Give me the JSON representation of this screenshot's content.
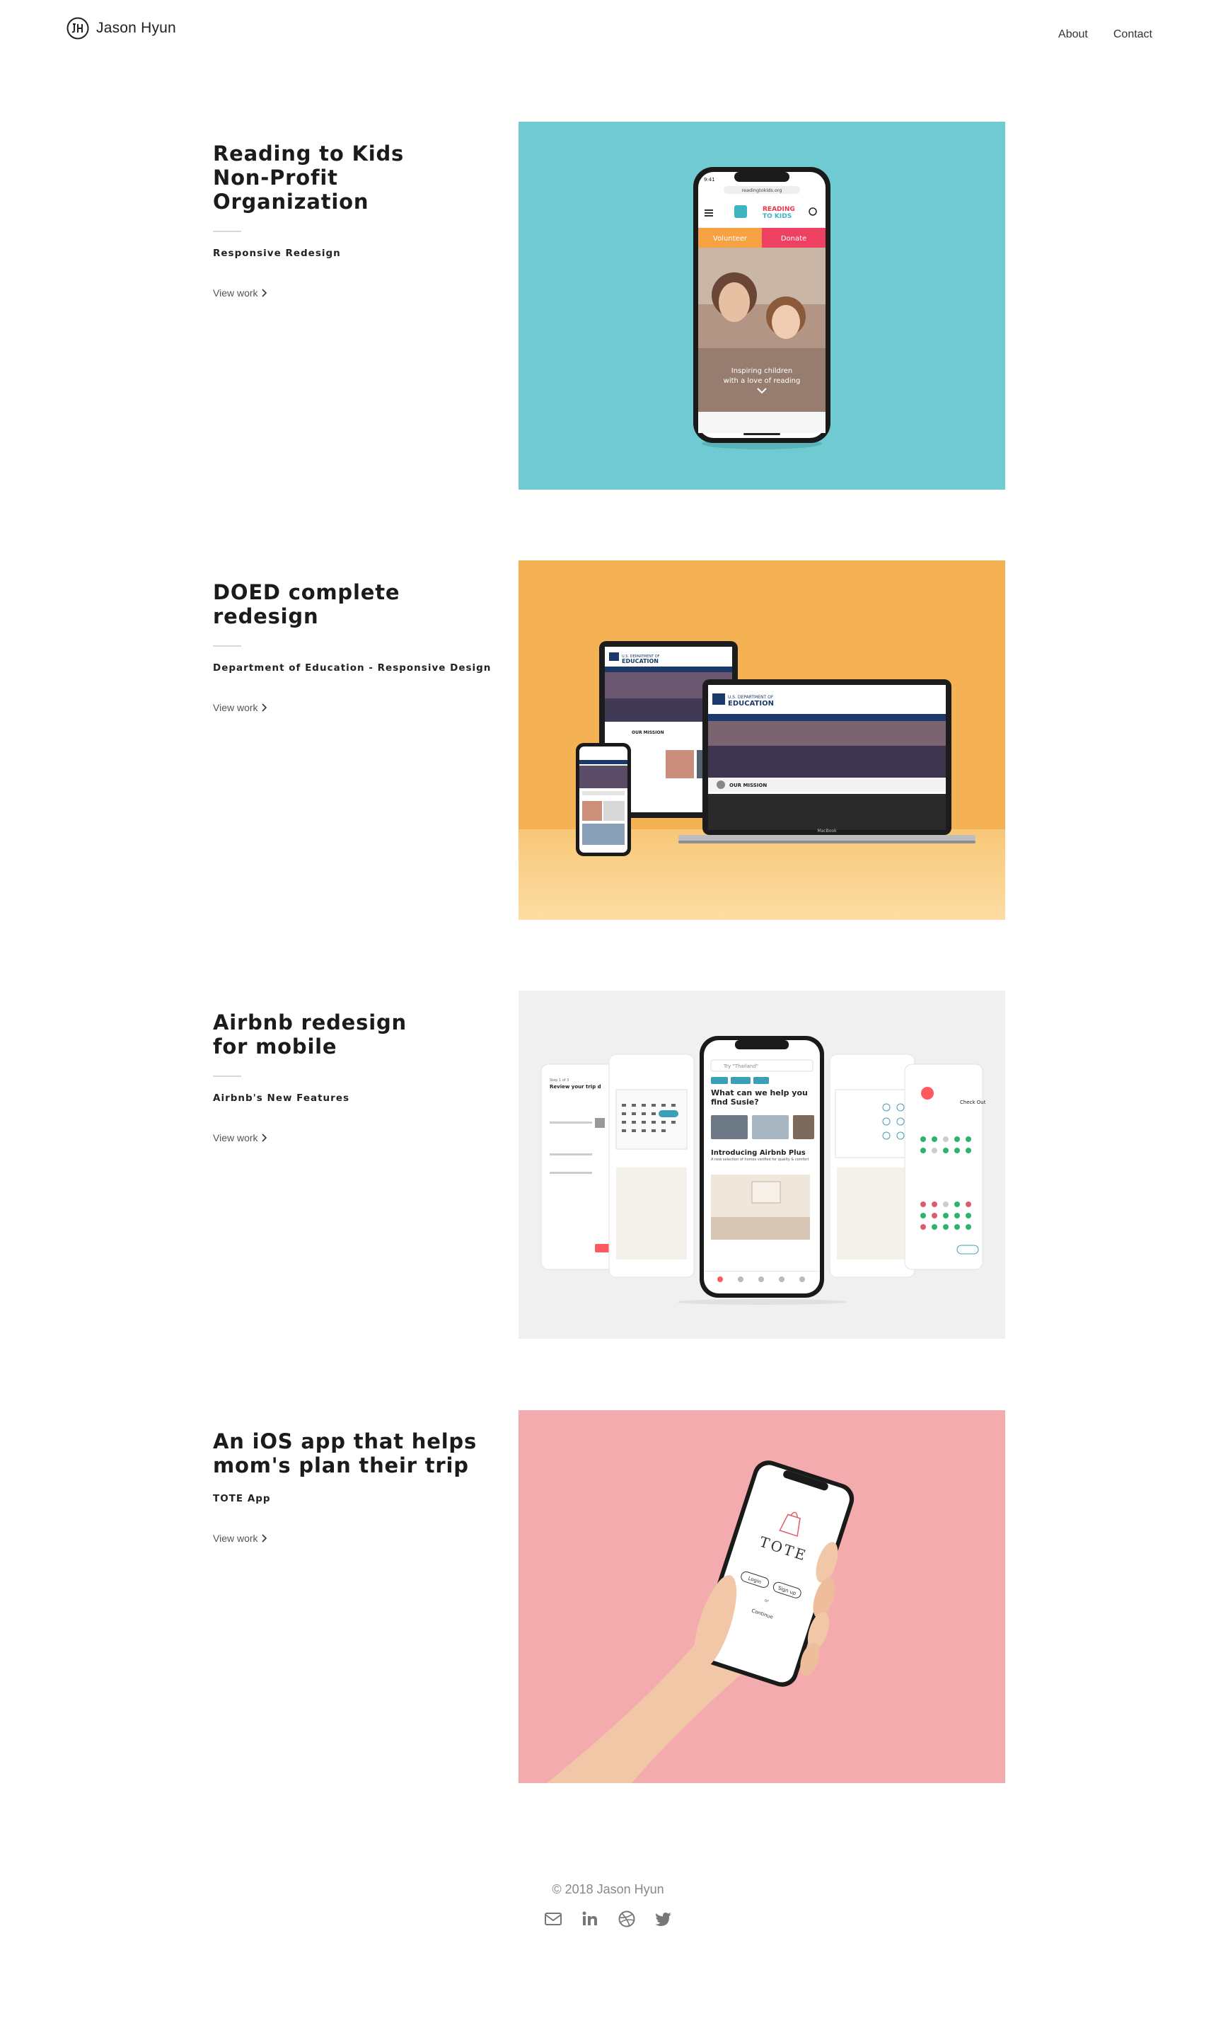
{
  "header": {
    "brand_name": "Jason Hyun",
    "nav": [
      {
        "label": "About"
      },
      {
        "label": "Contact"
      }
    ]
  },
  "projects": [
    {
      "title": "Reading to Kids\nNon-Profit Organization",
      "subtitle": "Responsive Redesign",
      "link": "View work",
      "bg": "#70CAD1"
    },
    {
      "title": "DOED complete\nredesign",
      "subtitle": "Department of Education - Responsive Design",
      "link": "View work",
      "bg": "#F6B85A"
    },
    {
      "title": "Airbnb redesign\nfor mobile",
      "subtitle": "Airbnb's New Features",
      "link": "View work",
      "bg": "#F0F0F0"
    },
    {
      "title": "An iOS app that helps\nmom's plan their trip",
      "subtitle": "TOTE App",
      "link": "View work",
      "bg": "#F4ABAE"
    }
  ],
  "mockups": {
    "rtk": {
      "url": "readingtokids.org",
      "logo_line1": "READING",
      "logo_line2": "TO KIDS",
      "volunteer": "Volunteer",
      "donate": "Donate",
      "hero_line1": "Inspiring children",
      "hero_line2": "with a love of reading"
    },
    "doed": {
      "logo_small": "U.S. DEPARTMENT OF",
      "logo_big": "EDUCATION",
      "mission": "OUR MISSION",
      "brand_caption": "MacBook"
    },
    "airbnb": {
      "search": "Try \"Thailand\"",
      "question": "What can we help you find Susie?",
      "plus_title": "Introducing Airbnb Plus",
      "plus_body": "A new selection of homes verified for quality & comfort",
      "left_title": "Review your trip d",
      "left_step": "Step 1 of 3",
      "right_title": "Check Out"
    },
    "tote": {
      "name": "TOTE",
      "login": "Login",
      "signup": "Sign up",
      "or": "or",
      "continue": "Continue"
    }
  },
  "footer": {
    "copyright": "© 2018 Jason Hyun",
    "socials": [
      "mail-icon",
      "linkedin-icon",
      "dribbble-icon",
      "twitter-icon"
    ]
  },
  "colors": {
    "rtk_bg": "#70CAD1",
    "doed_bg": "#F6B85A",
    "airbnb_bg": "#F0F0F0",
    "tote_bg": "#F4ABAE",
    "airbnb_accent": "#FF5A5F",
    "doed_navy": "#1B3A6B"
  }
}
